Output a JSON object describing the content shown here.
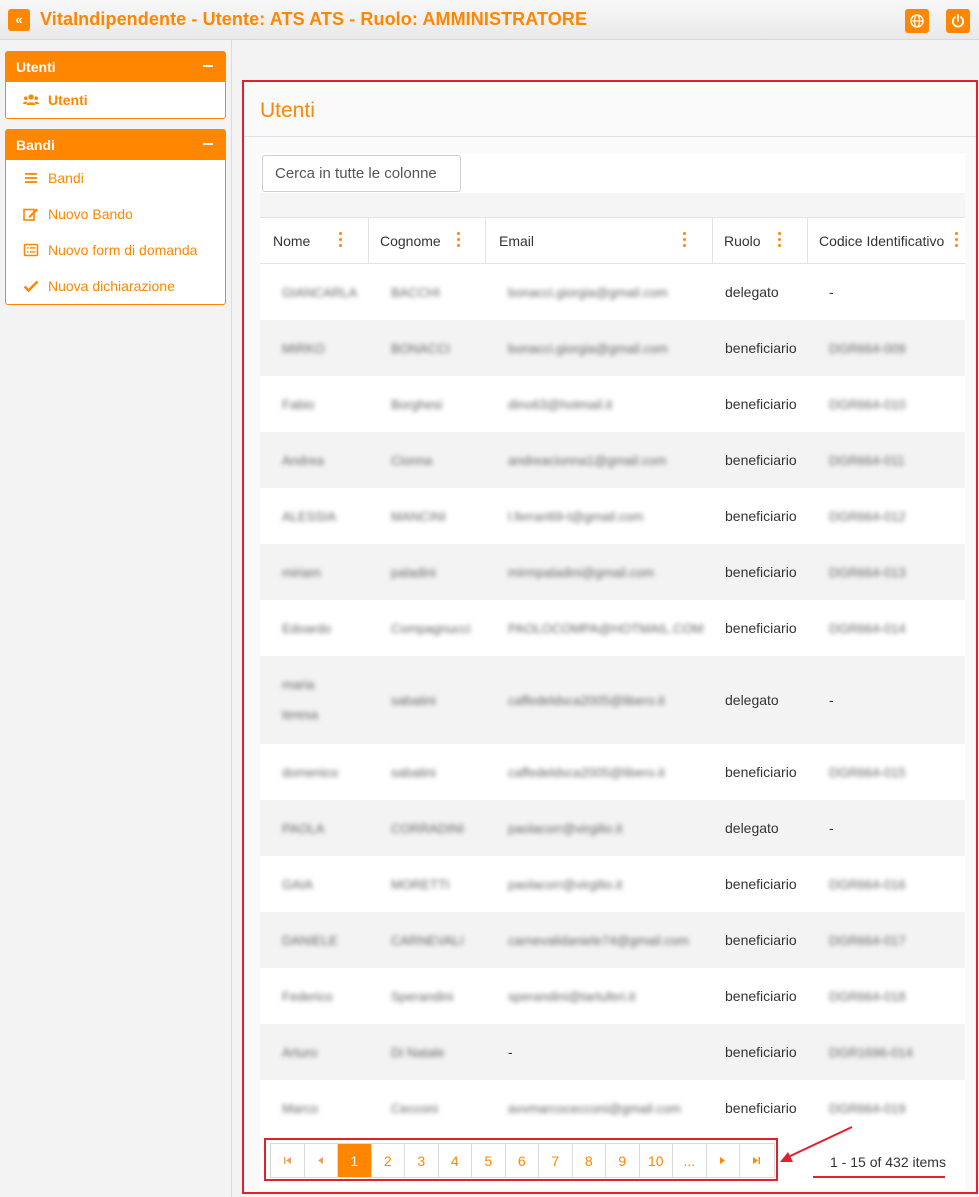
{
  "app": {
    "title": "VitaIndipendente - Utente: ATS ATS - Ruolo: AMMINISTRATORE",
    "collapse_icon": "double-chevron-left-icon",
    "language_icon": "globe-icon",
    "logout_icon": "power-icon",
    "accent": "#ff8600",
    "highlight": "#e0202a"
  },
  "sidebar": {
    "panels": [
      {
        "title": "Utenti",
        "items": [
          {
            "label": "Utenti",
            "icon": "users-icon"
          }
        ]
      },
      {
        "title": "Bandi",
        "items": [
          {
            "label": "Bandi",
            "icon": "list-icon"
          },
          {
            "label": "Nuovo Bando",
            "icon": "edit-icon"
          },
          {
            "label": "Nuovo form di domanda",
            "icon": "list-alt-icon"
          },
          {
            "label": "Nuova dichiarazione",
            "icon": "check-icon"
          }
        ]
      }
    ]
  },
  "main": {
    "page_title": "Utenti",
    "search": {
      "placeholder": "Cerca in tutte le colonne",
      "value": ""
    },
    "columns": [
      "Nome",
      "Cognome",
      "Email",
      "Ruolo",
      "Codice Identificativo"
    ],
    "rows": [
      {
        "nome": "GIANCARLA",
        "cognome": "BACCHI",
        "email": "bonacci.giorgia@gmail.com",
        "ruolo": "delegato",
        "codice": "-"
      },
      {
        "nome": "MIRKO",
        "cognome": "BONACCI",
        "email": "bonacci.giorgia@gmail.com",
        "ruolo": "beneficiario",
        "codice": "DGR664-009"
      },
      {
        "nome": "Fabio",
        "cognome": "Borghesi",
        "email": "dino63@hotmail.it",
        "ruolo": "beneficiario",
        "codice": "DGR664-010"
      },
      {
        "nome": "Andrea",
        "cognome": "Cionna",
        "email": "andreacionna1@gmail.com",
        "ruolo": "beneficiario",
        "codice": "DGR664-011"
      },
      {
        "nome": "ALESSIA",
        "cognome": "MANCINI",
        "email": "l.ferrari69-t@gmail.com",
        "ruolo": "beneficiario",
        "codice": "DGR664-012"
      },
      {
        "nome": "miriam",
        "cognome": "paladini",
        "email": "mirmpaladini@gmail.com",
        "ruolo": "beneficiario",
        "codice": "DGR664-013"
      },
      {
        "nome": "Edoardo",
        "cognome": "Compagnucci",
        "email": "PAOLOCOMPA@HOTMAIL.COM",
        "ruolo": "beneficiario",
        "codice": "DGR664-014"
      },
      {
        "nome": "maria teresa",
        "cognome": "sabatini",
        "email": "caffedeldsca2005@libero.it",
        "ruolo": "delegato",
        "codice": "-"
      },
      {
        "nome": "domenico",
        "cognome": "sabatini",
        "email": "caffedeldsca2005@libero.it",
        "ruolo": "beneficiario",
        "codice": "DGR664-015"
      },
      {
        "nome": "PAOLA",
        "cognome": "CORRADINI",
        "email": "paolacorr@virgilio.it",
        "ruolo": "delegato",
        "codice": "-"
      },
      {
        "nome": "GAIA",
        "cognome": "MORETTI",
        "email": "paolacorr@virgilio.it",
        "ruolo": "beneficiario",
        "codice": "DGR664-016"
      },
      {
        "nome": "DANIELE",
        "cognome": "CARNEVALI",
        "email": "carnevalidaniele74@gmail.com",
        "ruolo": "beneficiario",
        "codice": "DGR664-017"
      },
      {
        "nome": "Federico",
        "cognome": "Sperandini",
        "email": "sperandini@tartuferi.it",
        "ruolo": "beneficiario",
        "codice": "DGR664-018"
      },
      {
        "nome": "Arturo",
        "cognome": "Di Natale",
        "email": "-",
        "ruolo": "beneficiario",
        "codice": "DGR1696-014"
      },
      {
        "nome": "Marco",
        "cognome": "Cecconi",
        "email": "avvmarcocecconi@gmail.com",
        "ruolo": "beneficiario",
        "codice": "DGR664-019"
      }
    ]
  },
  "pager": {
    "first_icon": "first-page-icon",
    "prev_icon": "prev-page-icon",
    "next_icon": "next-page-icon",
    "last_icon": "last-page-icon",
    "pages": [
      "1",
      "2",
      "3",
      "4",
      "5",
      "6",
      "7",
      "8",
      "9",
      "10",
      "..."
    ],
    "current_page": "1",
    "info": "1 - 15 of 432 items"
  }
}
